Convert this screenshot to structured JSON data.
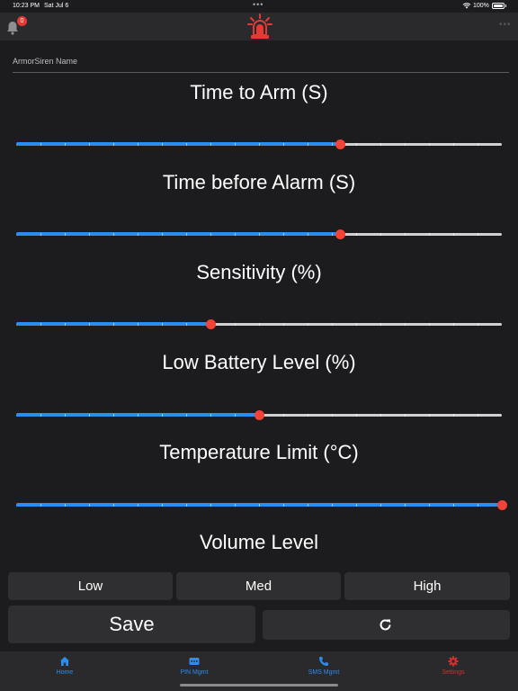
{
  "status_bar": {
    "time": "10:23 PM",
    "date": "Sat Jul 6",
    "dots": "•••",
    "battery_pct": "100%"
  },
  "header": {
    "notification_count": "0",
    "more": "•••"
  },
  "name_field": {
    "placeholder": "ArmorSiren Name"
  },
  "settings": [
    {
      "label": "Time to Arm (S)",
      "fill_fraction": 0.667
    },
    {
      "label": "Time before Alarm (S)",
      "fill_fraction": 0.667
    },
    {
      "label": "Sensitivity (%)",
      "fill_fraction": 0.4
    },
    {
      "label": "Low Battery Level (%)",
      "fill_fraction": 0.5
    },
    {
      "label": "Temperature Limit (°C)",
      "fill_fraction": 1.0
    }
  ],
  "volume": {
    "label": "Volume Level",
    "options": [
      "Low",
      "Med",
      "High"
    ]
  },
  "actions": {
    "save_label": "Save"
  },
  "tabs": [
    {
      "label": "Home",
      "icon": "home-icon"
    },
    {
      "label": "PIN Mgmt",
      "icon": "keypad-icon"
    },
    {
      "label": "SMS Mgmt",
      "icon": "phone-icon"
    },
    {
      "label": "Settings",
      "icon": "gear-icon",
      "active": true
    }
  ],
  "colors": {
    "accent": "#2c8df0",
    "thumb": "#f24336",
    "brand_red": "#e53935",
    "background": "#1c1c1e"
  }
}
